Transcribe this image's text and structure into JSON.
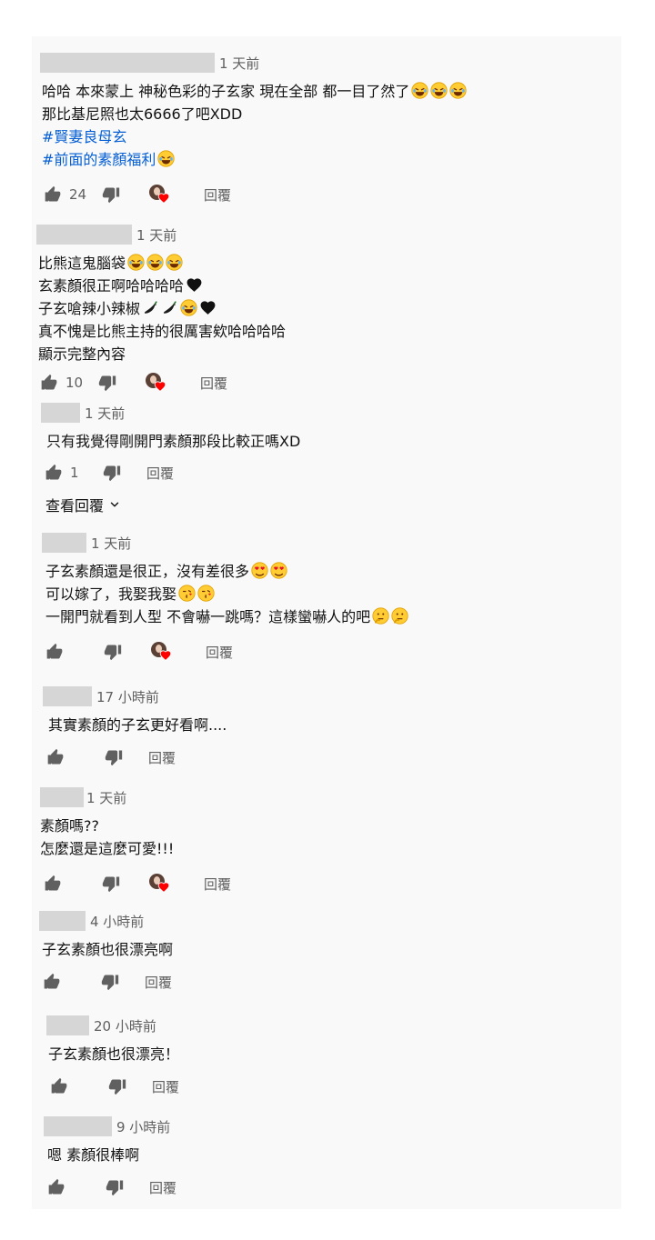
{
  "labels": {
    "reply": "回覆",
    "view_replies": "查看回覆"
  },
  "colors": {
    "panel_bg": "#f9f9f9",
    "name_blur": "#d6d6d6",
    "hashtag": "#065fd4",
    "heart": "#ff0000",
    "meta": "#606060"
  },
  "comments": [
    {
      "time": "1 天前",
      "lines": [
        "哈哈 本來蒙上 神秘色彩的子玄家 現在全部 都一目了然了",
        "那比基尼照也太6666了吧XDD",
        "#賢妻良母玄",
        "#前面的素顏福利"
      ],
      "emojis": [
        "tears-of-joy",
        "tears-of-joy",
        "tears-of-joy",
        "none",
        "none",
        "none",
        "grinning-sweat"
      ],
      "likes": "24",
      "hearted": true
    },
    {
      "time": "1 天前",
      "lines": [
        "比熊這鬼腦袋",
        "玄素顏很正啊哈哈哈哈",
        "子玄嗆辣小辣椒",
        "真不愧是比熊主持的很厲害欸哈哈哈哈",
        "顯示完整內容"
      ],
      "likes": "10",
      "hearted": true
    },
    {
      "time": "1 天前",
      "lines": [
        "只有我覺得剛開門素顏那段比較正嗎XD"
      ],
      "likes": "1",
      "hearted": false
    },
    {
      "time": "1 天前",
      "lines": [
        "子玄素顏還是很正，沒有差很多",
        "可以嫁了，我娶我娶",
        "一開門就看到人型 不會嚇一跳嗎？這樣蠻嚇人的吧"
      ],
      "likes": "",
      "hearted": true
    },
    {
      "time": "17 小時前",
      "lines": [
        "其實素顏的子玄更好看啊...."
      ],
      "likes": "",
      "hearted": false
    },
    {
      "time": "1 天前",
      "lines": [
        "素顏嗎??",
        "怎麼還是這麼可愛!!!"
      ],
      "likes": "",
      "hearted": true
    },
    {
      "time": "4 小時前",
      "lines": [
        "子玄素顏也很漂亮啊"
      ],
      "likes": "",
      "hearted": false
    },
    {
      "time": "20 小時前",
      "lines": [
        "子玄素顏也很漂亮！"
      ],
      "likes": "",
      "hearted": false
    },
    {
      "time": "9 小時前",
      "lines": [
        "嗯 素顏很棒啊"
      ],
      "likes": "",
      "hearted": false
    }
  ]
}
